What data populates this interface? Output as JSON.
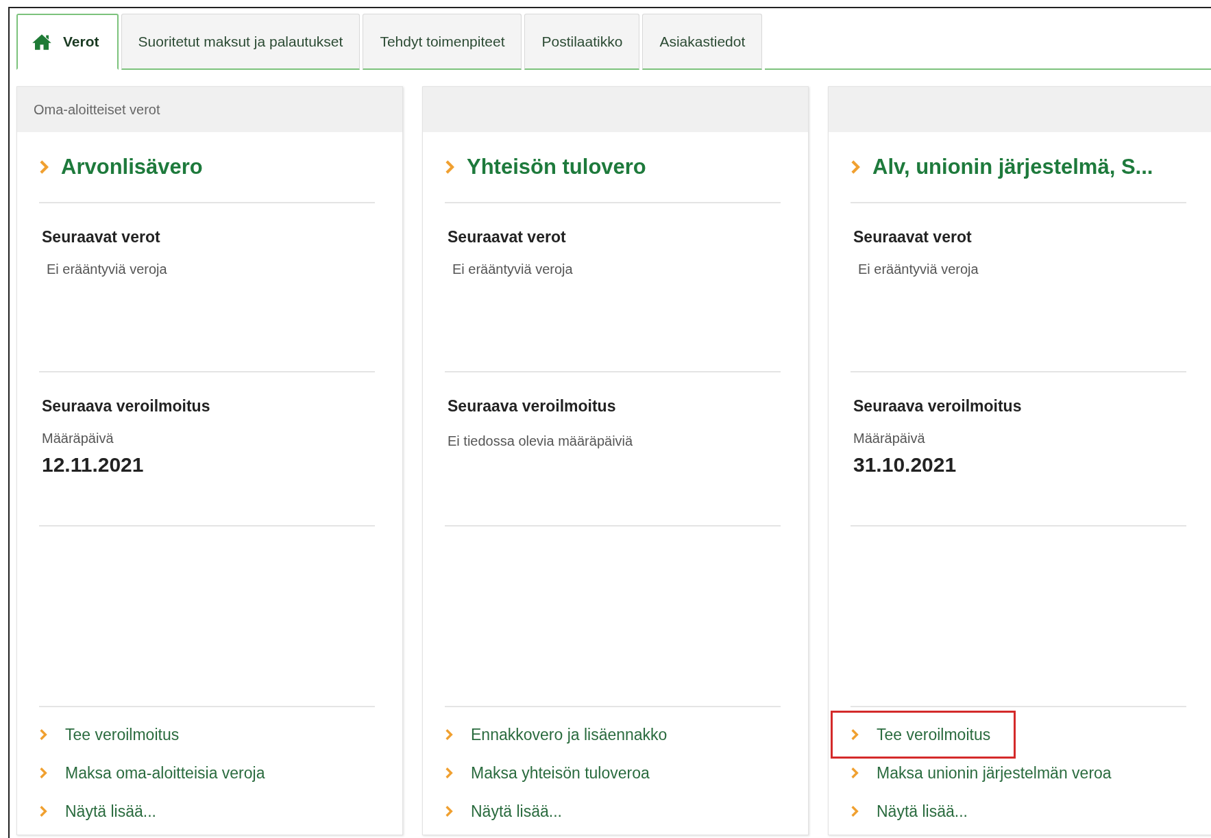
{
  "tabs": [
    {
      "kind": "home",
      "label": "Verot",
      "selected": true
    },
    {
      "kind": "plain",
      "label": "Suoritetut maksut ja palautukset",
      "selected": false
    },
    {
      "kind": "plain",
      "label": "Tehdyt toimenpiteet",
      "selected": false
    },
    {
      "kind": "plain",
      "label": "Postilaatikko",
      "selected": false
    },
    {
      "kind": "plain",
      "label": "Asiakastiedot",
      "selected": false
    }
  ],
  "cards": [
    {
      "header": "Oma-aloitteiset verot",
      "title": "Arvonlisävero",
      "sections": [
        {
          "kind": "text",
          "heading": "Seuraavat verot",
          "text": "Ei erääntyviä veroja"
        },
        {
          "kind": "deadline",
          "heading": "Seuraava veroilmoitus",
          "label": "Määräpäivä",
          "date": "12.11.2021"
        }
      ],
      "links": [
        {
          "label": "Tee veroilmoitus",
          "highlighted": false
        },
        {
          "label": "Maksa oma-aloitteisia veroja",
          "highlighted": false
        },
        {
          "label": "Näytä lisää...",
          "highlighted": false
        }
      ]
    },
    {
      "title": "Yhteisön tulovero",
      "sections": [
        {
          "kind": "text",
          "heading": "Seuraavat verot",
          "text": "Ei erääntyviä veroja"
        },
        {
          "kind": "note",
          "heading": "Seuraava veroilmoitus",
          "text": "Ei tiedossa olevia määräpäiviä"
        }
      ],
      "links": [
        {
          "label": "Ennakkovero ja lisäennakko",
          "highlighted": false
        },
        {
          "label": "Maksa yhteisön tuloveroa",
          "highlighted": false
        },
        {
          "label": "Näytä lisää...",
          "highlighted": false
        }
      ]
    },
    {
      "title": "Alv, unionin järjestelmä, S...",
      "sections": [
        {
          "kind": "text",
          "heading": "Seuraavat verot",
          "text": "Ei erääntyviä veroja"
        },
        {
          "kind": "deadline",
          "heading": "Seuraava veroilmoitus",
          "label": "Määräpäivä",
          "date": "31.10.2021"
        }
      ],
      "links": [
        {
          "label": "Tee veroilmoitus",
          "highlighted": true
        },
        {
          "label": "Maksa unionin järjestelmän veroa",
          "highlighted": false
        },
        {
          "label": "Näytä lisää...",
          "highlighted": false
        }
      ]
    }
  ]
}
